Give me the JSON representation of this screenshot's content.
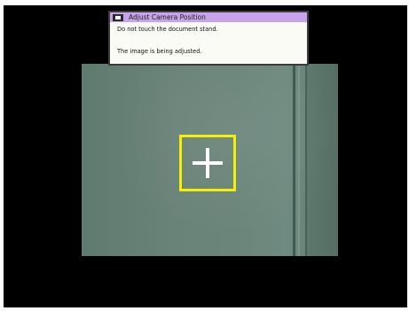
{
  "dialog": {
    "title": "Adjust Camera Position",
    "message_1": "Do not touch the document stand.",
    "message_2": "The image is being adjusted."
  },
  "colors": {
    "title_bar": "#c7a4ea",
    "target_box": "#f4f004",
    "background": "#000000",
    "camera_feed": "#6b857b"
  },
  "icons": {
    "title": "camera-window-icon",
    "center_target": "crosshair-icon"
  }
}
